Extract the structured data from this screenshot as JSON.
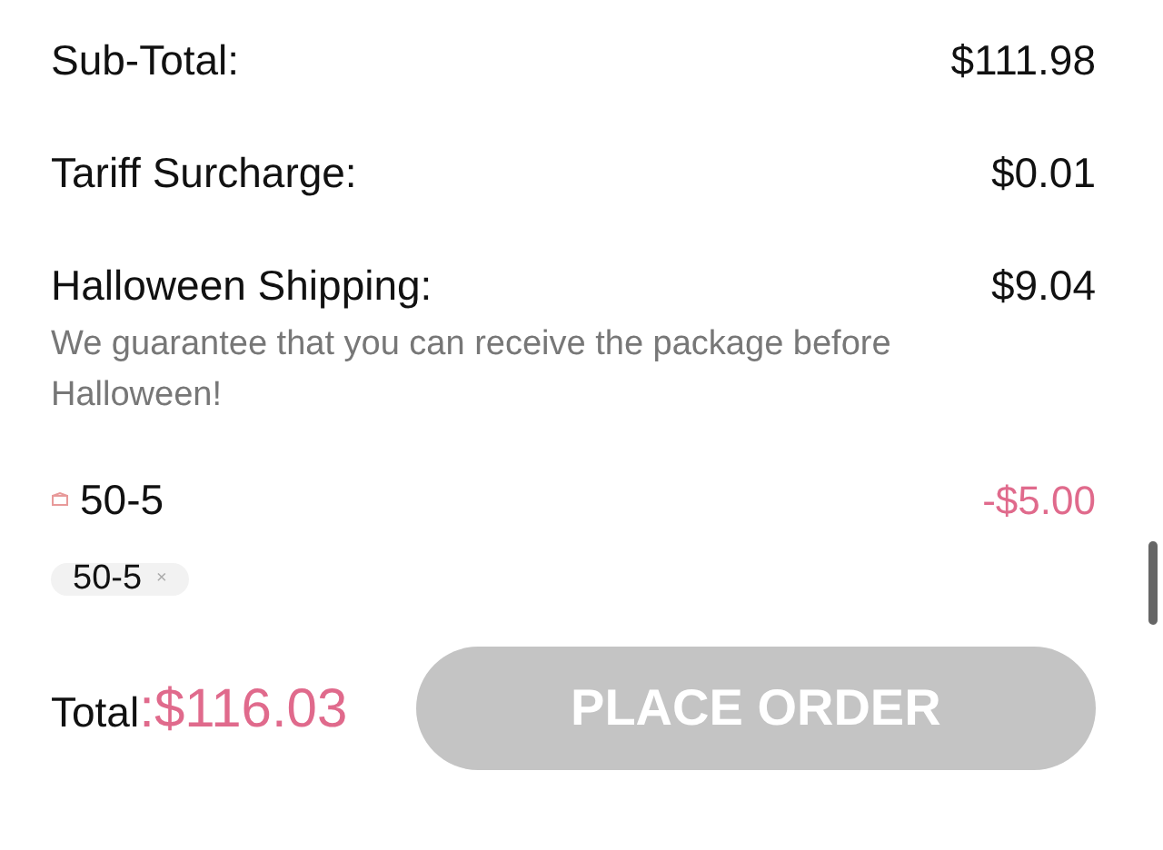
{
  "summary": [
    {
      "label": "Sub-Total:",
      "value": "$111.98"
    },
    {
      "label": "Tariff Surcharge:",
      "value": "$0.01"
    },
    {
      "label": "Halloween Shipping:",
      "value": "$9.04",
      "note": "We guarantee that you can receive the package before Halloween!"
    }
  ],
  "coupon": {
    "code": "50-5",
    "discount": "-$5.00"
  },
  "applied_tags": [
    {
      "label": "50-5",
      "remove": "×"
    }
  ],
  "total": {
    "label": "Total",
    "separator": ":",
    "amount": "$116.03"
  },
  "place_order": {
    "label": "PLACE ORDER",
    "disabled": true
  }
}
